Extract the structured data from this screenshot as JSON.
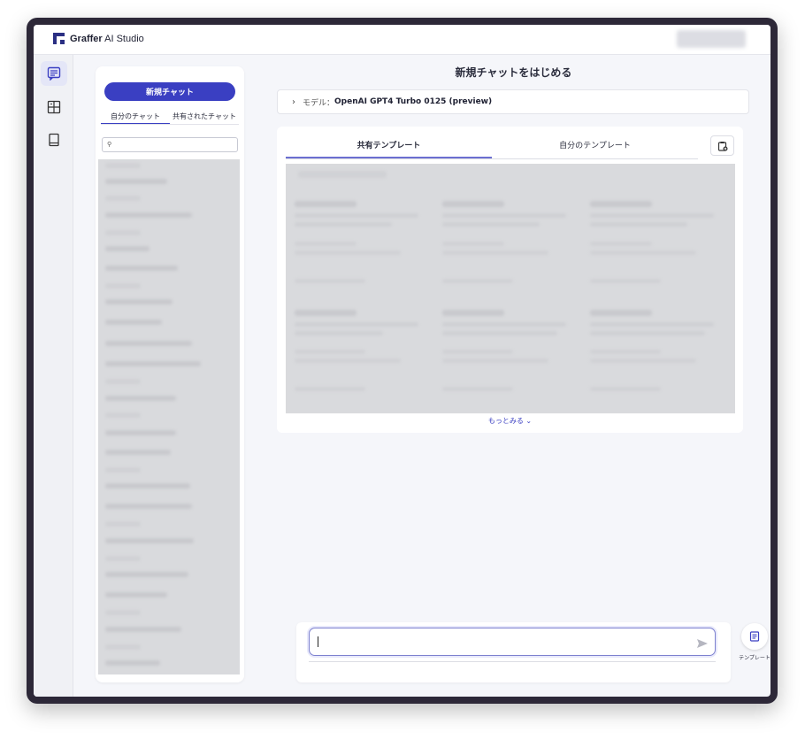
{
  "app": {
    "brand_bold": "Graffer",
    "brand_rest": " AI Studio"
  },
  "rail": {
    "icons": [
      "chat-icon",
      "template-grid-icon",
      "book-icon"
    ]
  },
  "sidebar": {
    "new_chat_label": "新規チャット",
    "tabs": [
      "自分のチャット",
      "共有されたチャット"
    ],
    "search_icon": "⚲"
  },
  "main": {
    "title": "新規チャットをはじめる",
    "model_prefix": "モデル：",
    "model_value": "OpenAI GPT4 Turbo 0125 (preview)",
    "template_tabs": [
      "共有テンプレート",
      "自分のテンプレート"
    ],
    "more_label": "もっとみる ⌄"
  },
  "composer": {
    "input_value": ""
  },
  "fab": {
    "label": "テンプレート"
  },
  "colors": {
    "accent": "#3a3fc2",
    "frame": "#2d2838"
  }
}
